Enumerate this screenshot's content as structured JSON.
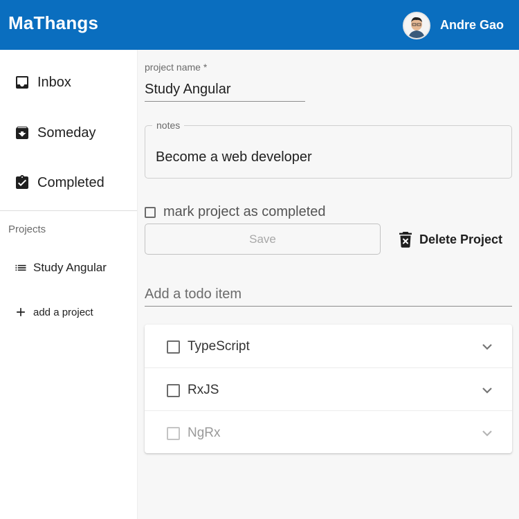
{
  "header": {
    "brand": "MaThangs",
    "user_name": "Andre Gao",
    "brand_color": "#0a6ebf"
  },
  "sidebar": {
    "nav": [
      {
        "label": "Inbox",
        "icon": "inbox-icon"
      },
      {
        "label": "Someday",
        "icon": "archive-icon"
      },
      {
        "label": "Completed",
        "icon": "clipboard-check-icon"
      }
    ],
    "projects_heading": "Projects",
    "projects": [
      {
        "label": "Study Angular",
        "icon": "list-icon"
      }
    ],
    "add_project_label": "add a project"
  },
  "main": {
    "project_name_label": "project name *",
    "project_name_value": "Study Angular",
    "notes_label": "notes",
    "notes_value": "Become a web developer",
    "mark_completed_label": "mark project as completed",
    "mark_completed_checked": false,
    "save_label": "Save",
    "delete_label": "Delete Project",
    "todo_placeholder": "Add a todo item",
    "todos": [
      {
        "label": "TypeScript",
        "completed": false
      },
      {
        "label": "RxJS",
        "completed": false
      },
      {
        "label": "NgRx",
        "completed": false
      }
    ]
  }
}
